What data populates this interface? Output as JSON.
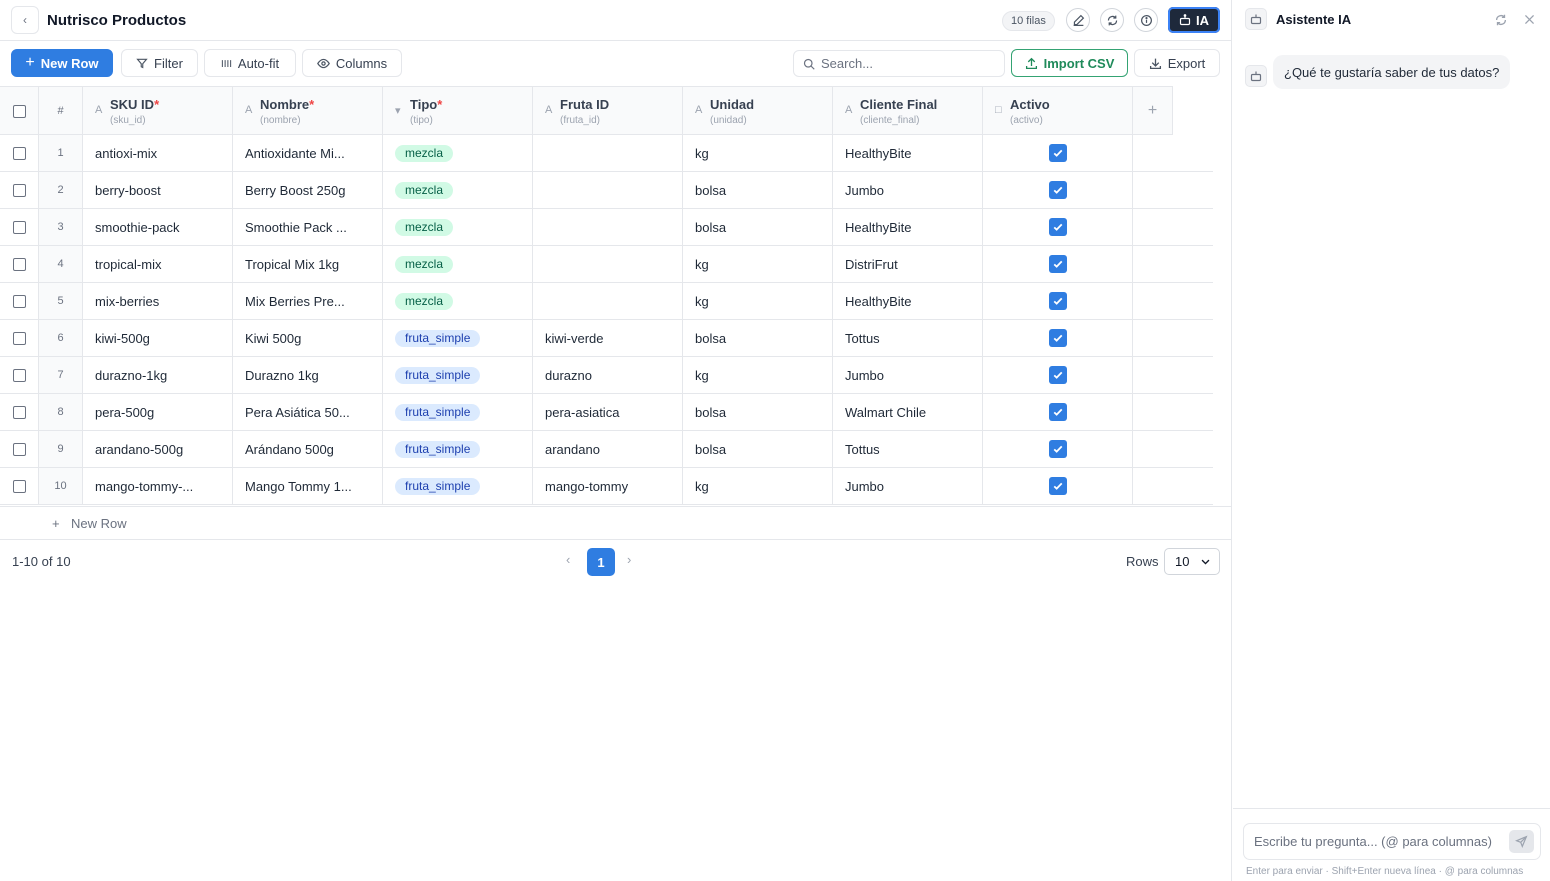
{
  "header": {
    "title": "Nutrisco Productos",
    "rows_badge": "10 filas",
    "ia_label": "IA"
  },
  "toolbar": {
    "new_row": "New Row",
    "filter": "Filter",
    "autofit": "Auto-fit",
    "columns": "Columns",
    "search_placeholder": "Search...",
    "import_csv": "Import CSV",
    "export": "Export"
  },
  "table": {
    "num_header": "#",
    "columns": [
      {
        "name": "SKU ID",
        "key": "(sku_id)",
        "required": true,
        "type_icon": "A"
      },
      {
        "name": "Nombre",
        "key": "(nombre)",
        "required": true,
        "type_icon": "A"
      },
      {
        "name": "Tipo",
        "key": "(tipo)",
        "required": true,
        "type_icon": "▾"
      },
      {
        "name": "Fruta ID",
        "key": "(fruta_id)",
        "required": false,
        "type_icon": "A"
      },
      {
        "name": "Unidad",
        "key": "(unidad)",
        "required": false,
        "type_icon": "A"
      },
      {
        "name": "Cliente Final",
        "key": "(cliente_final)",
        "required": false,
        "type_icon": "A"
      },
      {
        "name": "Activo",
        "key": "(activo)",
        "required": false,
        "type_icon": "□"
      }
    ],
    "add_column": "+",
    "rows": [
      {
        "n": "1",
        "sku": "antioxi-mix",
        "nombre": "Antioxidante Mi...",
        "tipo": "mezcla",
        "fruta": "",
        "unidad": "kg",
        "cliente": "HealthyBite",
        "activo": true
      },
      {
        "n": "2",
        "sku": "berry-boost",
        "nombre": "Berry Boost 250g",
        "tipo": "mezcla",
        "fruta": "",
        "unidad": "bolsa",
        "cliente": "Jumbo",
        "activo": true
      },
      {
        "n": "3",
        "sku": "smoothie-pack",
        "nombre": "Smoothie Pack ...",
        "tipo": "mezcla",
        "fruta": "",
        "unidad": "bolsa",
        "cliente": "HealthyBite",
        "activo": true
      },
      {
        "n": "4",
        "sku": "tropical-mix",
        "nombre": "Tropical Mix 1kg",
        "tipo": "mezcla",
        "fruta": "",
        "unidad": "kg",
        "cliente": "DistriFrut",
        "activo": true
      },
      {
        "n": "5",
        "sku": "mix-berries",
        "nombre": "Mix Berries Pre...",
        "tipo": "mezcla",
        "fruta": "",
        "unidad": "kg",
        "cliente": "HealthyBite",
        "activo": true
      },
      {
        "n": "6",
        "sku": "kiwi-500g",
        "nombre": "Kiwi 500g",
        "tipo": "fruta_simple",
        "fruta": "kiwi-verde",
        "unidad": "bolsa",
        "cliente": "Tottus",
        "activo": true
      },
      {
        "n": "7",
        "sku": "durazno-1kg",
        "nombre": "Durazno 1kg",
        "tipo": "fruta_simple",
        "fruta": "durazno",
        "unidad": "kg",
        "cliente": "Jumbo",
        "activo": true
      },
      {
        "n": "8",
        "sku": "pera-500g",
        "nombre": "Pera Asiática 50...",
        "tipo": "fruta_simple",
        "fruta": "pera-asiatica",
        "unidad": "bolsa",
        "cliente": "Walmart Chile",
        "activo": true
      },
      {
        "n": "9",
        "sku": "arandano-500g",
        "nombre": "Arándano 500g",
        "tipo": "fruta_simple",
        "fruta": "arandano",
        "unidad": "bolsa",
        "cliente": "Tottus",
        "activo": true
      },
      {
        "n": "10",
        "sku": "mango-tommy-...",
        "nombre": "Mango Tommy 1...",
        "tipo": "fruta_simple",
        "fruta": "mango-tommy",
        "unidad": "kg",
        "cliente": "Jumbo",
        "activo": true
      }
    ],
    "new_row_footer": "New Row"
  },
  "pagination": {
    "info": "1-10 of 10",
    "current_page": "1",
    "rows_label": "Rows",
    "rows_value": "10"
  },
  "assistant": {
    "title": "Asistente IA",
    "message": "¿Qué te gustaría saber de tus datos?",
    "input_placeholder": "Escribe tu pregunta... (@ para columnas)",
    "hint": "Enter para enviar · Shift+Enter nueva línea · @ para columnas"
  },
  "colors": {
    "accent": "#2f7de1",
    "import_green": "#1f8a5a",
    "mezcla_bg": "#d1fae5",
    "fruta_bg": "#dbeafe",
    "required": "#ef4444"
  },
  "icons": [
    "back-icon",
    "edit-icon",
    "refresh-icon",
    "info-icon",
    "robot-icon",
    "plus-icon",
    "filter-icon",
    "columns-icon",
    "eye-icon",
    "search-icon",
    "upload-icon",
    "download-icon",
    "check-icon",
    "send-icon",
    "close-icon"
  ]
}
